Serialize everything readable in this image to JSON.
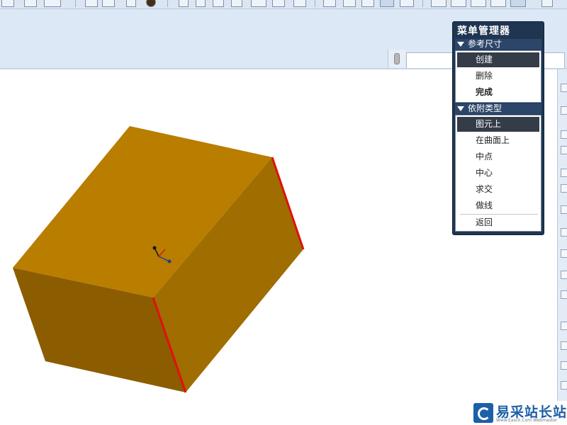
{
  "menu_manager": {
    "title": "菜单管理器",
    "sections": [
      {
        "header": "参考尺寸",
        "items": [
          {
            "label": "创建",
            "selected": true,
            "bold": false
          },
          {
            "label": "删除",
            "selected": false,
            "bold": false
          },
          {
            "label": "完成",
            "selected": false,
            "bold": true
          }
        ]
      },
      {
        "header": "依附类型",
        "items": [
          {
            "label": "图元上",
            "selected": true,
            "bold": false
          },
          {
            "label": "在曲面上",
            "selected": false,
            "bold": false
          },
          {
            "label": "中点",
            "selected": false,
            "bold": false
          },
          {
            "label": "中心",
            "selected": false,
            "bold": false
          },
          {
            "label": "求交",
            "selected": false,
            "bold": false
          },
          {
            "label": "做线",
            "selected": false,
            "bold": false
          }
        ]
      }
    ],
    "return_label": "返回"
  },
  "watermark": {
    "text": "易采站长站",
    "subtext": "Www.Easck.Com Webmaster"
  },
  "colors": {
    "top_face": "#b97d00",
    "left_face": "#8c5c00",
    "right_face": "#a06d00",
    "highlight_edge": "#e01010",
    "menu_bg": "#1f3550",
    "selected_item": "#343c48"
  }
}
